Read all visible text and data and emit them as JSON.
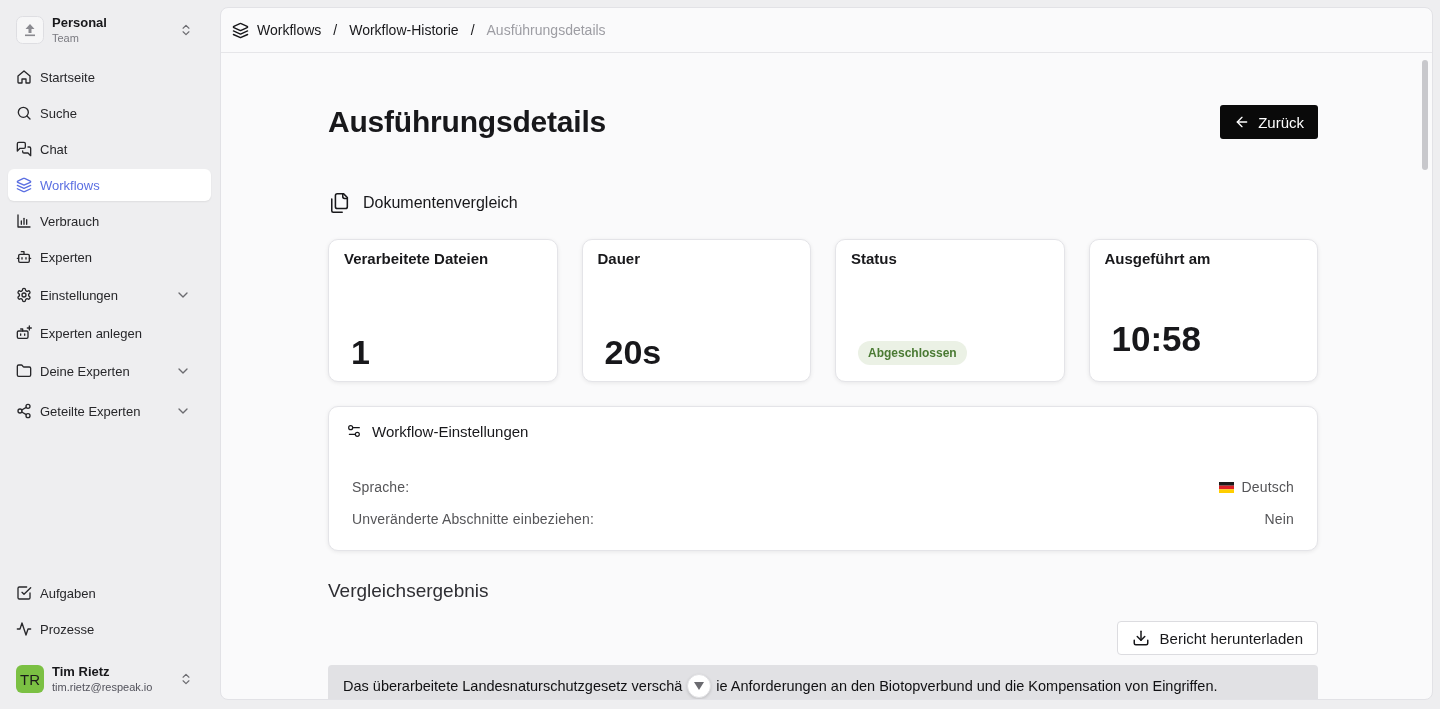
{
  "sidebar": {
    "workspace": {
      "name": "Personal",
      "subtitle": "Team"
    },
    "nav_items": [
      {
        "label": "Startseite",
        "kind": "link",
        "selected": false
      },
      {
        "label": "Suche",
        "kind": "link",
        "selected": false
      },
      {
        "label": "Chat",
        "kind": "link",
        "selected": false
      },
      {
        "label": "Workflows",
        "kind": "link",
        "selected": true
      },
      {
        "label": "Verbrauch",
        "kind": "link",
        "selected": false
      },
      {
        "label": "Experten",
        "kind": "link",
        "selected": false
      },
      {
        "label": "Einstellungen",
        "kind": "group",
        "selected": false,
        "expanded": false
      },
      {
        "label": "Experten anlegen",
        "kind": "link",
        "selected": false
      },
      {
        "label": "Deine Experten",
        "kind": "group",
        "selected": false,
        "expanded": false
      },
      {
        "label": "Geteilte Experten",
        "kind": "group",
        "selected": false,
        "expanded": false
      }
    ],
    "footer_items": [
      {
        "label": "Aufgaben",
        "selected": false
      },
      {
        "label": "Prozesse",
        "selected": false
      }
    ],
    "user": {
      "initials": "TR",
      "name": "Tim Rietz",
      "email": "tim.rietz@respeak.io"
    }
  },
  "breadcrumb": {
    "separator": "/",
    "items": [
      {
        "label": "Workflows",
        "current": false
      },
      {
        "label": "Workflow-Historie",
        "current": false
      },
      {
        "label": "Ausführungsdetails",
        "current": true
      }
    ]
  },
  "page": {
    "title": "Ausführungsdetails",
    "back_button": "Zurück"
  },
  "workflow_type": "Dokumentenvergleich",
  "stats": [
    {
      "label": "Verarbeitete Dateien",
      "value": "1",
      "kind": "number"
    },
    {
      "label": "Dauer",
      "value": "20s",
      "kind": "number"
    },
    {
      "label": "Status",
      "value": "Abgeschlossen",
      "kind": "badge"
    },
    {
      "label": "Ausgeführt am",
      "value": "10:58",
      "kind": "time"
    }
  ],
  "settings": {
    "title": "Workflow-Einstellungen",
    "rows": [
      {
        "label": "Sprache:",
        "value": "Deutsch",
        "kind": "language"
      },
      {
        "label": "Unveränderte Abschnitte einbeziehen:",
        "value": "Nein",
        "kind": "text"
      }
    ]
  },
  "result": {
    "title": "Vergleichsergebnis",
    "download_button": "Bericht herunterladen",
    "summary_parts": [
      "Das überarbeitete Landesnaturschutzgesetz verschä",
      "ie Anforderungen an den Biotopverbund und die Kompensation von Eingriffen."
    ]
  }
}
